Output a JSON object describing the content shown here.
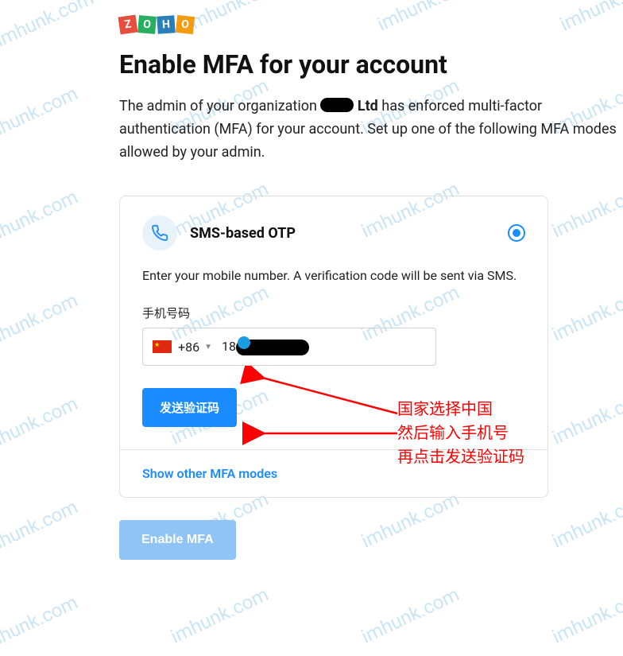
{
  "watermark_text": "imhunk.com",
  "logo_letters": [
    "Z",
    "O",
    "H",
    "O"
  ],
  "heading": "Enable MFA for your account",
  "description_part1": "The admin of your organization ",
  "description_org_suffix": " Ltd",
  "description_part2": " has enforced multi-factor authentication (MFA) for your account. Set up one of the following MFA modes allowed by your admin.",
  "card": {
    "title": "SMS-based OTP",
    "description": "Enter your mobile number. A verification code will be sent via SMS.",
    "field_label": "手机号码",
    "country_code": "+86",
    "phone_prefix": "18",
    "send_button": "发送验证码",
    "show_other": "Show other MFA modes"
  },
  "enable_button": "Enable MFA",
  "annotation": {
    "line1": "国家选择中国",
    "line2": "然后输入手机号",
    "line3": "再点击发送验证码"
  }
}
